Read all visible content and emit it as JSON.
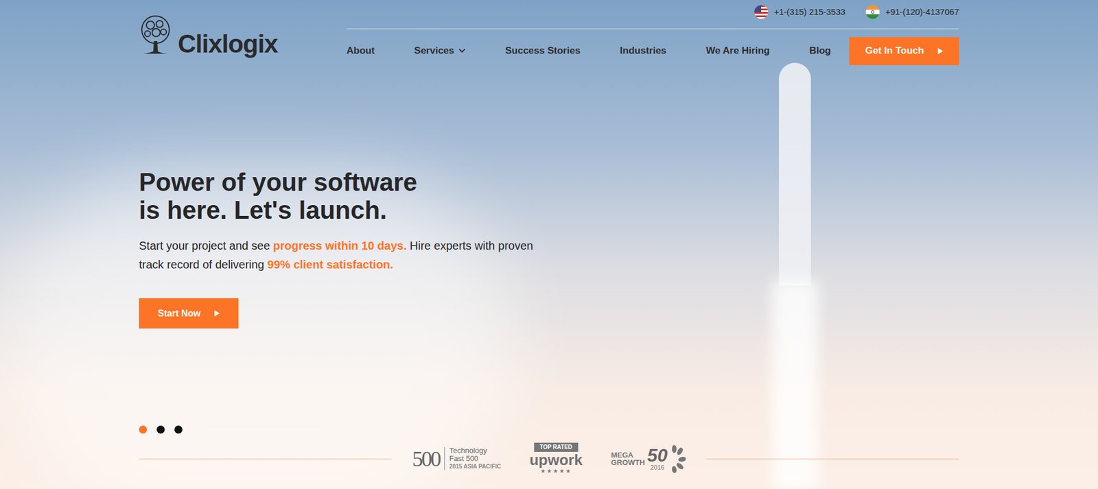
{
  "logo": {
    "text": "Clixlogix"
  },
  "contacts": [
    {
      "phone": "+1-(315) 215-3533"
    },
    {
      "phone": "+91-(120)-4137067"
    }
  ],
  "nav": [
    {
      "label": "About",
      "dropdown": false
    },
    {
      "label": "Services",
      "dropdown": true
    },
    {
      "label": "Success Stories",
      "dropdown": false
    },
    {
      "label": "Industries",
      "dropdown": false
    },
    {
      "label": "We Are Hiring",
      "dropdown": false
    },
    {
      "label": "Blog",
      "dropdown": false
    }
  ],
  "cta": {
    "label": "Get In Touch"
  },
  "hero": {
    "title_lines": [
      "Power of your software",
      "is here. Let's launch."
    ],
    "subtitle": [
      {
        "text": "Start your project and see ",
        "highlight": false
      },
      {
        "text": "progress within 10 days.",
        "highlight": true
      },
      {
        "text": " Hire experts with proven track record of delivering ",
        "highlight": false
      },
      {
        "text": "99% client satisfaction.",
        "highlight": true
      }
    ],
    "button": "Start Now"
  },
  "slider_dots": [
    {
      "selected": true
    },
    {
      "selected": false
    },
    {
      "selected": false
    }
  ],
  "awards": [
    {
      "kind": "fast500",
      "big": "500",
      "lines": [
        "Technology",
        "Fast 500",
        "2015 ASIA PACIFIC"
      ]
    },
    {
      "kind": "toprated",
      "badge": "TOP RATED",
      "name": "upwork",
      "stars": "★★★★★"
    },
    {
      "kind": "megagrowth",
      "lines": [
        "MEGA",
        "GROWTH"
      ],
      "big": "50",
      "year": "2016"
    }
  ]
}
